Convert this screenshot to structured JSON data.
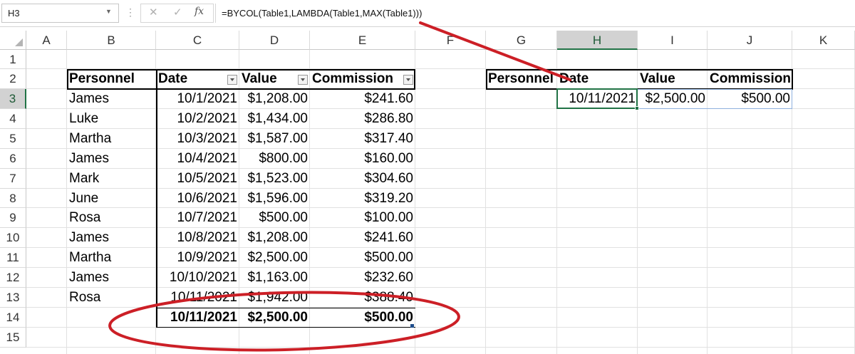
{
  "name_box": "H3",
  "formula": "=BYCOL(Table1,LAMBDA(Table1,MAX(Table1)))",
  "fx_label": "fx",
  "columns": [
    "A",
    "B",
    "C",
    "D",
    "E",
    "F",
    "G",
    "H",
    "I",
    "J",
    "K"
  ],
  "rows": [
    "1",
    "2",
    "3",
    "4",
    "5",
    "6",
    "7",
    "8",
    "9",
    "10",
    "11",
    "12",
    "13",
    "14",
    "15"
  ],
  "table_headers": [
    "Personnel",
    "Date",
    "Value",
    "Commission"
  ],
  "table_rows": [
    [
      "James",
      "10/1/2021",
      "$1,208.00",
      "$241.60"
    ],
    [
      "Luke",
      "10/2/2021",
      "$1,434.00",
      "$286.80"
    ],
    [
      "Martha",
      "10/3/2021",
      "$1,587.00",
      "$317.40"
    ],
    [
      "James",
      "10/4/2021",
      "$800.00",
      "$160.00"
    ],
    [
      "Mark",
      "10/5/2021",
      "$1,523.00",
      "$304.60"
    ],
    [
      "June",
      "10/6/2021",
      "$1,596.00",
      "$319.20"
    ],
    [
      "Rosa",
      "10/7/2021",
      "$500.00",
      "$100.00"
    ],
    [
      "James",
      "10/8/2021",
      "$1,208.00",
      "$241.60"
    ],
    [
      "Martha",
      "10/9/2021",
      "$2,500.00",
      "$500.00"
    ],
    [
      "James",
      "10/10/2021",
      "$1,163.00",
      "$232.60"
    ],
    [
      "Rosa",
      "10/11/2021",
      "$1,942.00",
      "$388.40"
    ]
  ],
  "total_row": [
    "",
    "10/11/2021",
    "$2,500.00",
    "$500.00"
  ],
  "result_headers": [
    "Personnel",
    "Date",
    "Value",
    "Commission"
  ],
  "result_values": [
    "10/11/2021",
    "$2,500.00",
    "$500.00"
  ],
  "colors": {
    "annotation_red": "#cc1f26",
    "excel_green": "#217346"
  }
}
